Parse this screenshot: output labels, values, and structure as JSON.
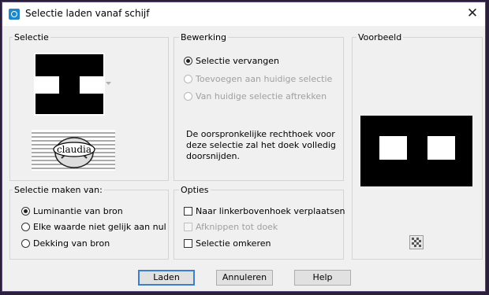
{
  "window": {
    "title": "Selectie laden vanaf schijf",
    "close_glyph": "✕"
  },
  "selectie": {
    "label": "Selectie",
    "dropdown_icon": "chevron-down-icon"
  },
  "bewerking": {
    "label": "Bewerking",
    "options": [
      {
        "label": "Selectie vervangen",
        "checked": true,
        "enabled": true
      },
      {
        "label": "Toevoegen aan huidige selectie",
        "checked": false,
        "enabled": false
      },
      {
        "label": "Van huidige selectie aftrekken",
        "checked": false,
        "enabled": false
      }
    ],
    "note": "De oorspronkelijke rechthoek voor deze selectie zal het doek volledig doorsnijden."
  },
  "voorbeeld": {
    "label": "Voorbeeld"
  },
  "selectie_maken": {
    "label": "Selectie maken van:",
    "options": [
      {
        "label": "Luminantie van bron",
        "checked": true
      },
      {
        "label": "Elke waarde niet gelijk aan nul",
        "checked": false
      },
      {
        "label": "Dekking van bron",
        "checked": false
      }
    ]
  },
  "opties": {
    "label": "Opties",
    "items": [
      {
        "label": "Naar linkerbovenhoek verplaatsen",
        "checked": false,
        "enabled": true
      },
      {
        "label": "Afknippen tot doek",
        "checked": false,
        "enabled": false
      },
      {
        "label": "Selectie omkeren",
        "checked": false,
        "enabled": true
      }
    ]
  },
  "buttons": {
    "load": "Laden",
    "cancel": "Annuleren",
    "help": "Help"
  },
  "watermark": {
    "text": "claudia"
  }
}
